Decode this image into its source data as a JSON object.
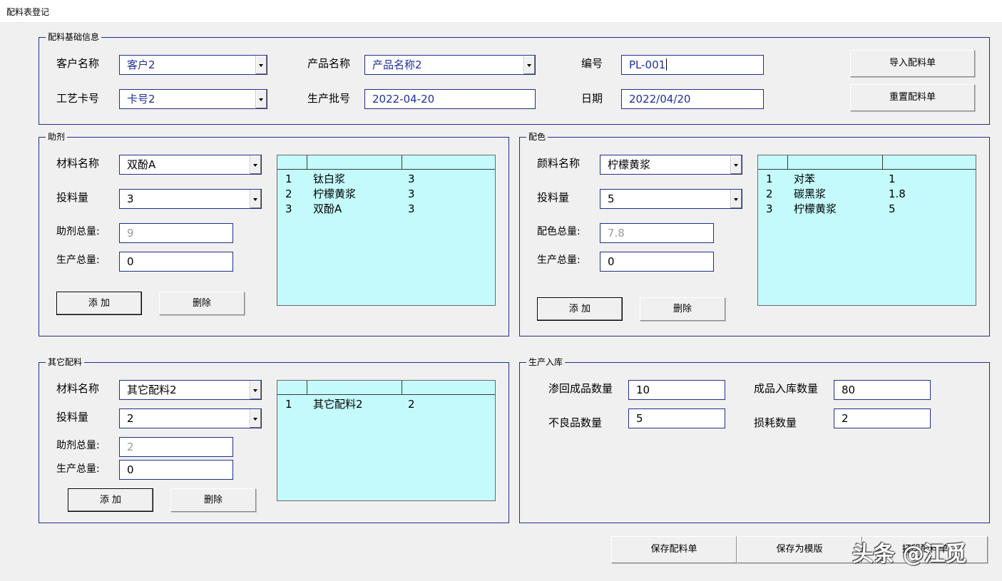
{
  "window": {
    "title": "配料表登记"
  },
  "basic": {
    "legend": "配料基础信息",
    "customer_label": "客户名称",
    "customer_value": "客户2",
    "product_label": "产品名称",
    "product_value": "产品名称2",
    "code_label": "编号",
    "code_value": "PL-001",
    "card_label": "工艺卡号",
    "card_value": "卡号2",
    "batch_label": "生产批号",
    "batch_value": "2022-04-20",
    "date_label": "日期",
    "date_value": "2022/04/20",
    "import_button": "导入配料单",
    "reset_button": "重置配料单"
  },
  "additive": {
    "legend": "助剂",
    "material_label": "材料名称",
    "material_value": "双酚A",
    "qty_label": "投料量",
    "qty_value": "3",
    "total_label": "助剂总量:",
    "total_value": "9",
    "prod_total_label": "生产总量:",
    "prod_total_value": "0",
    "add_button": "添 加",
    "delete_button": "删除",
    "rows": [
      {
        "no": "1",
        "name": "钛白浆",
        "qty": "3"
      },
      {
        "no": "2",
        "name": "柠檬黄浆",
        "qty": "3"
      },
      {
        "no": "3",
        "name": "双酚A",
        "qty": "3"
      }
    ]
  },
  "color": {
    "legend": "配色",
    "pigment_label": "颜料名称",
    "pigment_value": "柠檬黄浆",
    "qty_label": "投料量",
    "qty_value": "5",
    "total_label": "配色总量:",
    "total_value": "7.8",
    "prod_total_label": "生产总量:",
    "prod_total_value": "0",
    "add_button": "添 加",
    "delete_button": "删除",
    "rows": [
      {
        "no": "1",
        "name": "对苯",
        "qty": "1"
      },
      {
        "no": "2",
        "name": "碳黑浆",
        "qty": "1.8"
      },
      {
        "no": "3",
        "name": "柠檬黄浆",
        "qty": "5"
      }
    ]
  },
  "other": {
    "legend": "其它配料",
    "material_label": "材料名称",
    "material_value": "其它配料2",
    "qty_label": "投料量",
    "qty_value": "2",
    "total_label": "助剂总量:",
    "total_value": "2",
    "prod_total_label": "生产总量:",
    "prod_total_value": "0",
    "add_button": "添 加",
    "delete_button": "删除",
    "rows": [
      {
        "no": "1",
        "name": "其它配料2",
        "qty": "2"
      }
    ]
  },
  "warehouse": {
    "legend": "生产入库",
    "returned_label": "渗回成品数量",
    "returned_value": "10",
    "stored_label": "成品入库数量",
    "stored_value": "80",
    "defect_label": "不良品数量",
    "defect_value": "5",
    "loss_label": "损耗数量",
    "loss_value": "2"
  },
  "footer": {
    "save_button": "保存配料单",
    "save_template_button": "保存为模版",
    "print_button": "打印配料单"
  },
  "watermark": "头条 @江觅",
  "colors": {
    "group_border": "#1f2f8a",
    "listbox_bg": "#c4fafb",
    "value_blue": "#1f2fa0"
  }
}
